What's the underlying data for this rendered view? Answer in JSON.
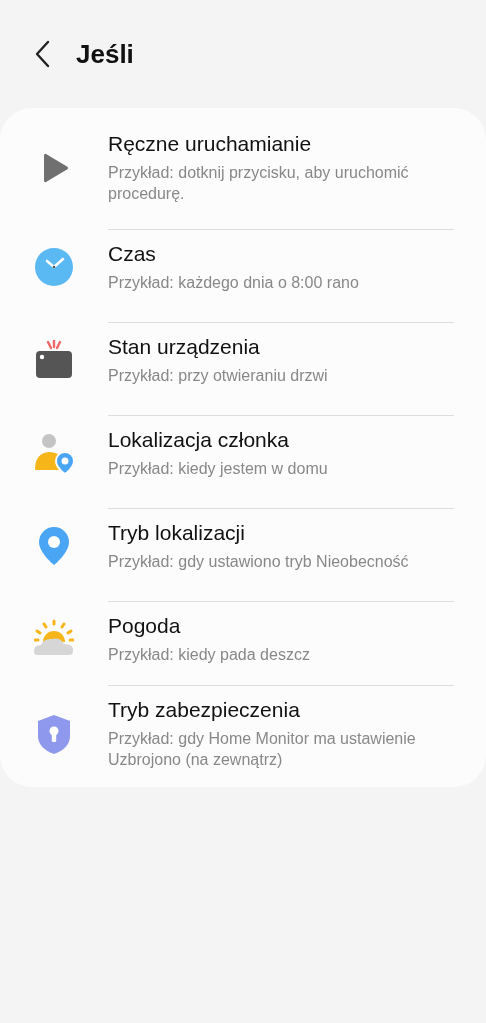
{
  "header": {
    "title": "Jeśli"
  },
  "items": [
    {
      "kind": "manual",
      "title": "Ręczne uruchamianie",
      "example": "Przykład: dotknij przycisku, aby uruchomić procedurę."
    },
    {
      "kind": "time",
      "title": "Czas",
      "example": "Przykład: każdego dnia o 8:00 rano"
    },
    {
      "kind": "device",
      "title": "Stan urządzenia",
      "example": "Przykład: przy otwieraniu drzwi"
    },
    {
      "kind": "member",
      "title": "Lokalizacja członka",
      "example": "Przykład: kiedy jestem w domu"
    },
    {
      "kind": "location",
      "title": "Tryb lokalizacji",
      "example": "Przykład: gdy ustawiono tryb Nieobecność"
    },
    {
      "kind": "weather",
      "title": "Pogoda",
      "example": "Przykład: kiedy pada deszcz"
    },
    {
      "kind": "security",
      "title": "Tryb zabezpieczenia",
      "example": "Przykład: gdy Home Monitor ma ustawienie Uzbrojono (na zewnątrz)"
    }
  ]
}
